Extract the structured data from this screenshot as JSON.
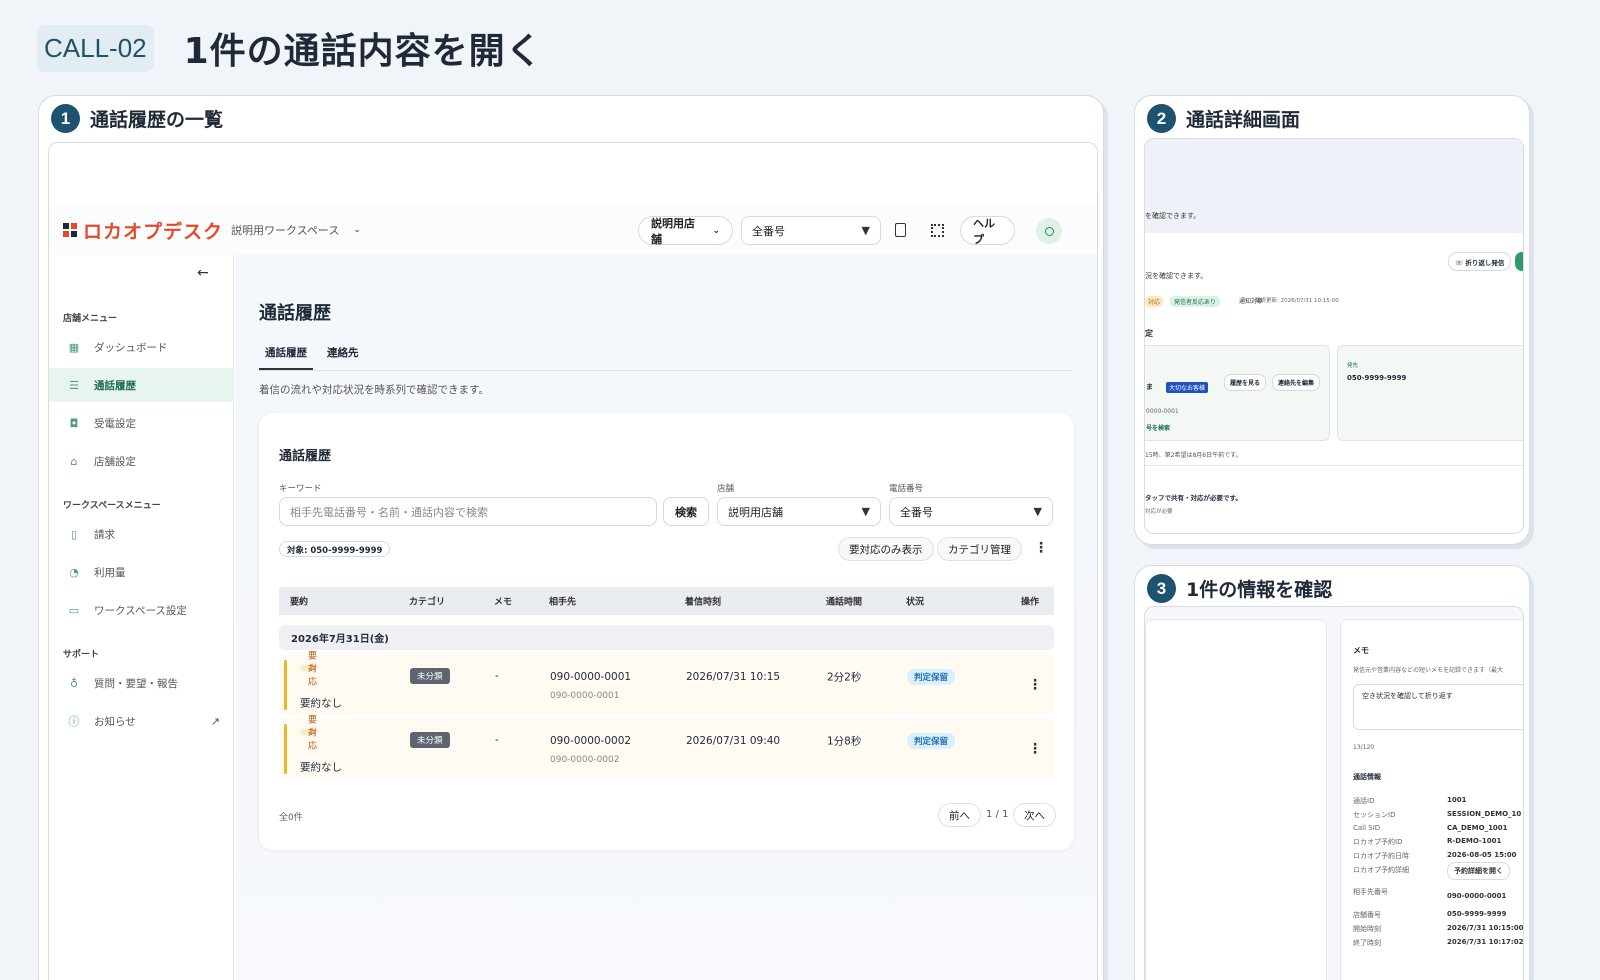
{
  "header": {
    "id": "CALL-02",
    "title": "1件の通話内容を開く"
  },
  "panels": {
    "p1": {
      "num": "1",
      "title": "通話履歴の一覧"
    },
    "p2": {
      "num": "2",
      "title": "通話詳細画面"
    },
    "p3": {
      "num": "3",
      "title": "1件の情報を確認"
    }
  },
  "app": {
    "logo": "ロカオプデスク",
    "workspace": "説明用ワークスペース",
    "store_select": "説明用店舗",
    "number_select": "全番号",
    "help": "ヘルプ"
  },
  "sidebar": {
    "sec1": "店舗メニュー",
    "sec2": "ワークスペースメニュー",
    "sec3": "サポート",
    "items": [
      "ダッシュボード",
      "通話履歴",
      "受電設定",
      "店舗設定",
      "請求",
      "利用量",
      "ワークスペース設定",
      "質問・要望・報告",
      "お知らせ"
    ]
  },
  "page": {
    "title": "通話履歴",
    "tab1": "通話履歴",
    "tab2": "連絡先",
    "desc": "着信の流れや対応状況を時系列で確認できます。"
  },
  "card": {
    "title": "通話履歴",
    "kw_label": "キーワード",
    "kw_placeholder": "相手先電話番号・名前・通話内容で検索",
    "search_btn": "検索",
    "store_label": "店舗",
    "store_value": "説明用店舗",
    "phone_label": "電話番号",
    "phone_value": "全番号",
    "target": "対象: 050-9999-9999",
    "only_btn": "要対応のみ表示",
    "cat_btn": "カテゴリ管理",
    "columns": [
      "要約",
      "カテゴリ",
      "メモ",
      "相手先",
      "着信時刻",
      "通話時間",
      "状況",
      "操作"
    ],
    "date_group": "2026年7月31日(金)",
    "rows": [
      {
        "badge": "要対応",
        "summary": "要約なし",
        "category": "未分類",
        "memo": "-",
        "number": "090-0000-0001",
        "number_sub": "090-0000-0001",
        "time": "2026/07/31 10:15",
        "duration": "2分2秒",
        "status": "判定保留"
      },
      {
        "badge": "要対応",
        "summary": "要約なし",
        "category": "未分類",
        "memo": "-",
        "number": "090-0000-0002",
        "number_sub": "090-0000-0002",
        "time": "2026/07/31 09:40",
        "duration": "1分8秒",
        "status": "判定保留"
      }
    ],
    "total": "全0件",
    "prev": "前へ",
    "page": "1 / 1",
    "next": "次へ"
  },
  "detail": {
    "t1": "を確認できます。",
    "callback": "折り返し発信",
    "t2": "況を確認できます。",
    "tag1": "対応",
    "tag2": "発信者反応あり",
    "tag3": "通知対象",
    "updated": "最終更新: 2026/07/31 10:15:00",
    "t3": "定",
    "t4": "ま",
    "vip": "大切なお客様",
    "history_btn": "履歴を見る",
    "edit_btn": "連絡先を編集",
    "dest_label": "発先",
    "dest": "050-9999-9999",
    "num_partial": "0000-0001",
    "search_link": "号を検索",
    "note": "15時、第2希望は8月6日午前です。",
    "t5": "タッフで共有・対応が必要です。",
    "t6": "対応が必要"
  },
  "info": {
    "memo_title": "メモ",
    "memo_desc": "発信元や営業内容などの短いメモを記録できます（最大",
    "memo_value": "空き状況を確認して折り返す",
    "count": "13/120",
    "section": "通話情報",
    "fields": [
      {
        "k": "通話ID",
        "v": "1001"
      },
      {
        "k": "セッションID",
        "v": "SESSION_DEMO_10"
      },
      {
        "k": "Call SID",
        "v": "CA_DEMO_1001"
      },
      {
        "k": "ロカオプ予約ID",
        "v": "R-DEMO-1001"
      },
      {
        "k": "ロカオプ予約日時",
        "v": "2026-08-05 15:00"
      },
      {
        "k": "ロカオプ予約詳細",
        "v": "予約詳細を開く"
      },
      {
        "k": "相手先番号",
        "v": "090-0000-0001"
      },
      {
        "k": "店舗番号",
        "v": "050-9999-9999"
      },
      {
        "k": "開始時刻",
        "v": "2026/7/31 10:15:00"
      },
      {
        "k": "終了時刻",
        "v": "2026/7/31 10:17:02"
      }
    ]
  }
}
